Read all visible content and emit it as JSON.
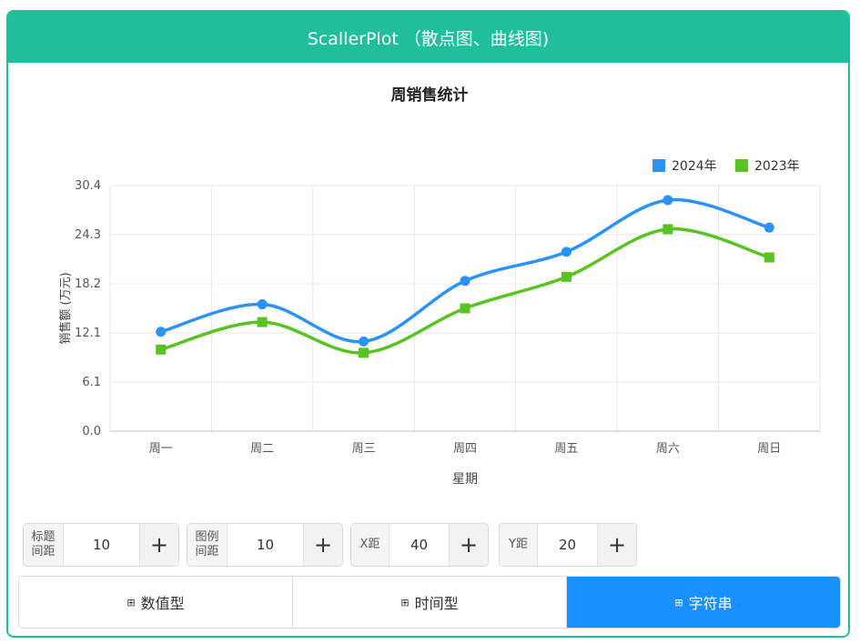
{
  "header": {
    "title": "ScallerPlot （散点图、曲线图)"
  },
  "chart_data": {
    "type": "line",
    "title": "周销售统计",
    "xlabel": "星期",
    "ylabel": "销售额 (万元)",
    "categories": [
      "周一",
      "周二",
      "周三",
      "周四",
      "周五",
      "周六",
      "周日"
    ],
    "y_ticks": [
      "0.0",
      "6.1",
      "12.1",
      "18.2",
      "24.3",
      "30.4"
    ],
    "ylim": [
      0,
      30.4
    ],
    "grid": true,
    "legend_position": "top-right",
    "smooth": true,
    "series": [
      {
        "name": "2024年",
        "color": "#2a93f5",
        "marker": "circle",
        "values": [
          12.3,
          15.7,
          11.1,
          18.6,
          22.2,
          28.6,
          25.2
        ]
      },
      {
        "name": "2023年",
        "color": "#58c321",
        "marker": "square",
        "values": [
          10.1,
          13.5,
          9.7,
          15.2,
          19.1,
          25.0,
          21.5
        ]
      }
    ]
  },
  "controls": [
    {
      "label": "标题\n间距",
      "value": "10"
    },
    {
      "label": "图例\n间距",
      "value": "10"
    },
    {
      "label": "X距",
      "value": "40"
    },
    {
      "label": "Y距",
      "value": "20"
    }
  ],
  "plus_symbol": "+",
  "tab_icon": "⊞",
  "tabs": [
    {
      "label": "数值型",
      "active": false
    },
    {
      "label": "时间型",
      "active": false
    },
    {
      "label": "字符串",
      "active": true
    }
  ]
}
